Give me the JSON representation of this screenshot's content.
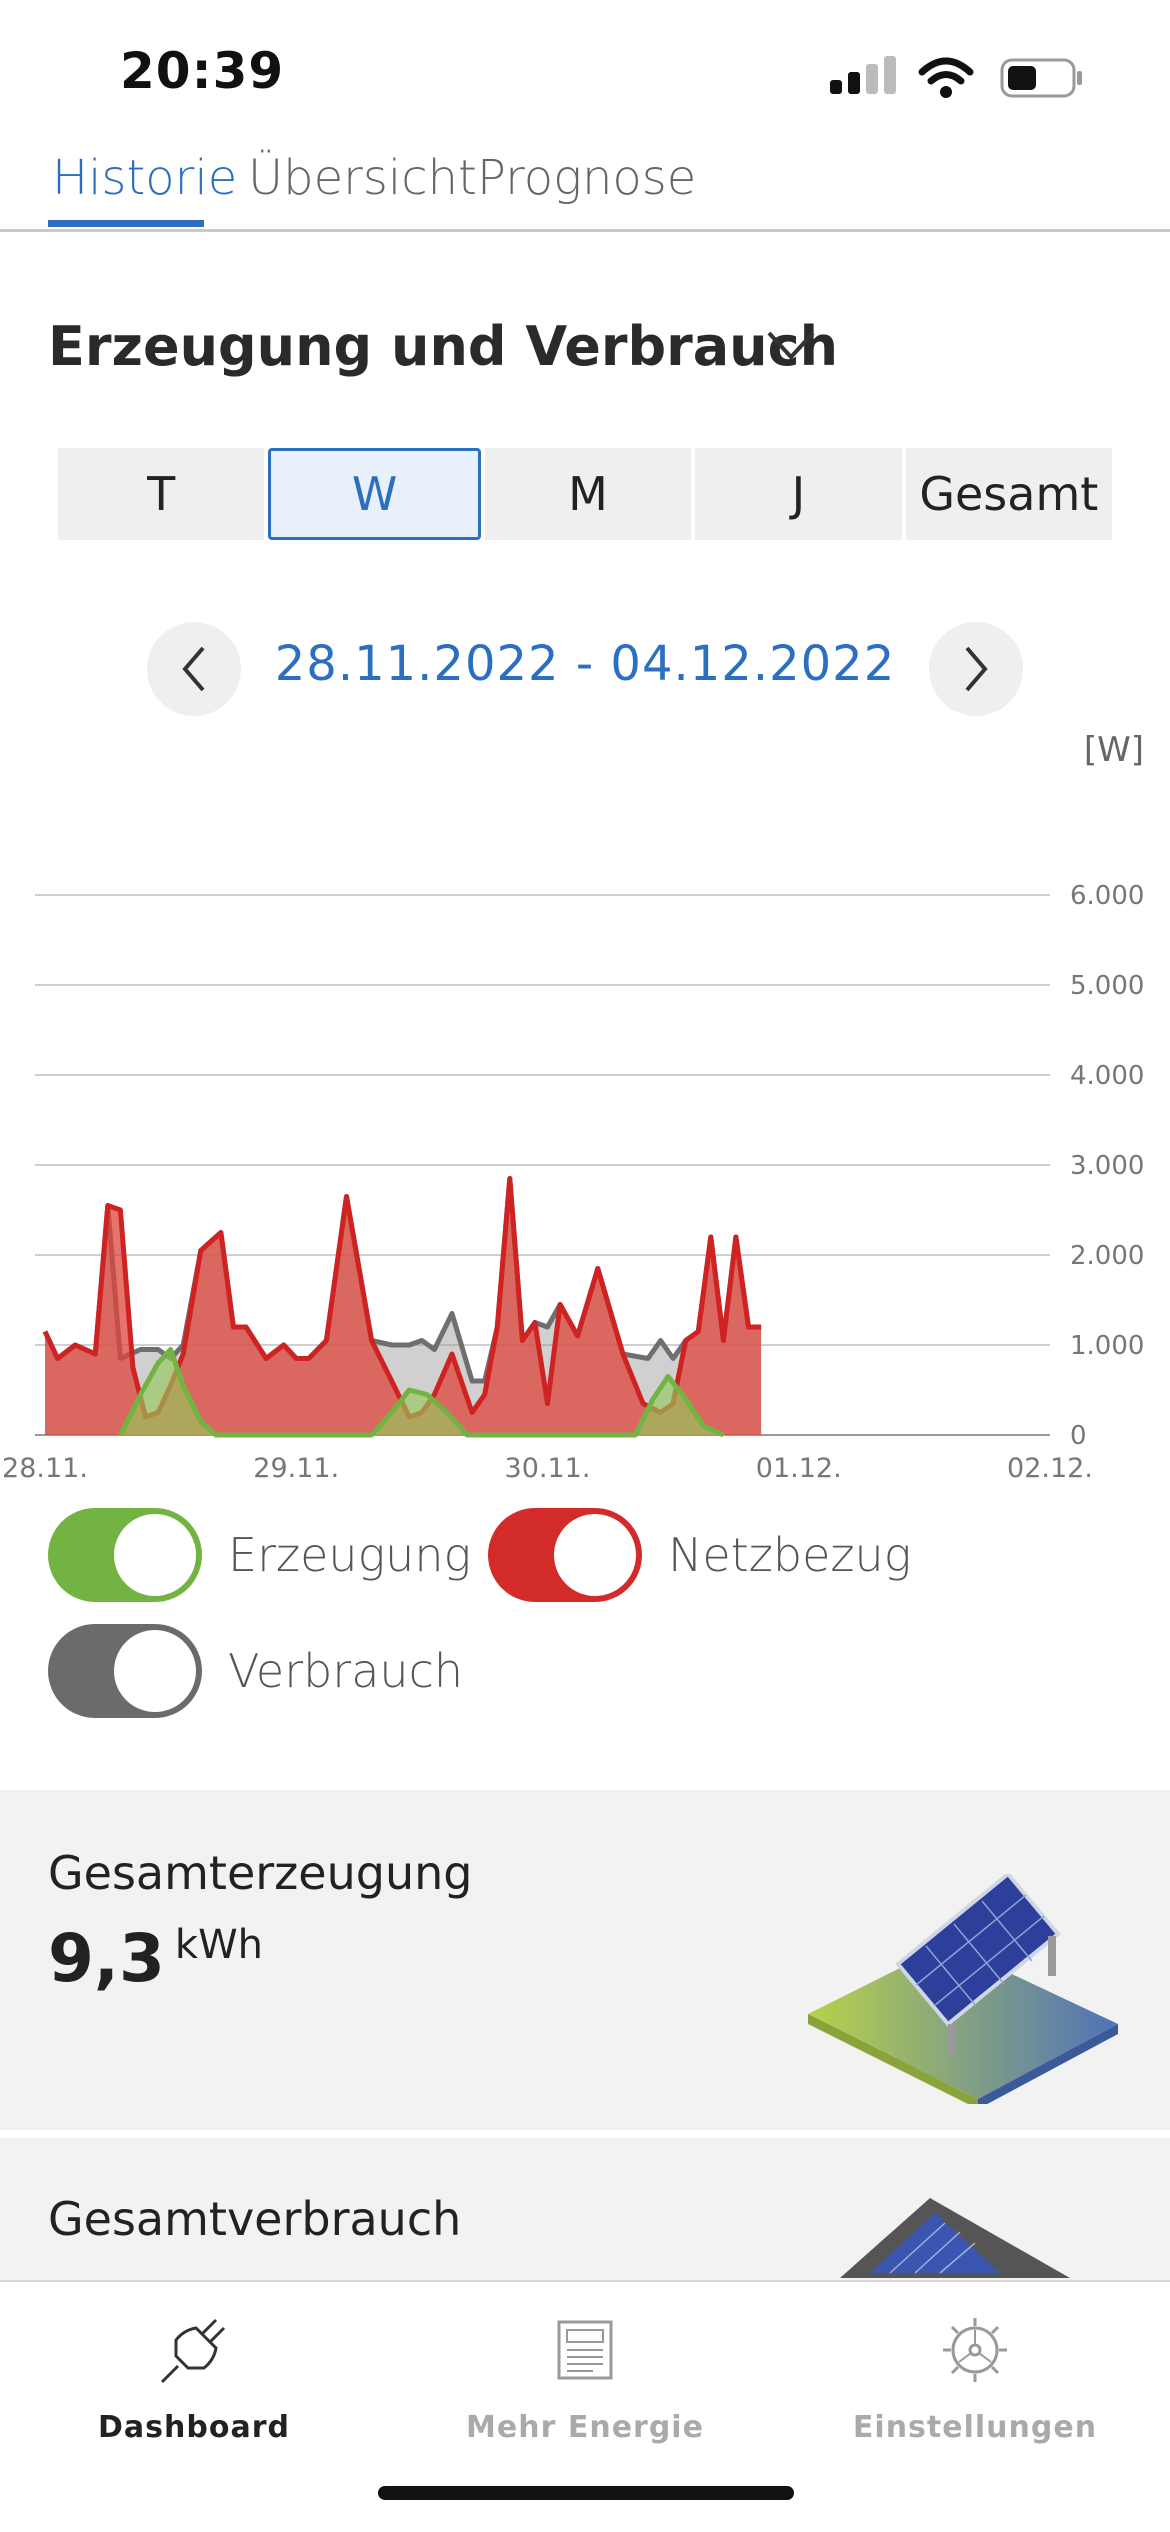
{
  "status": {
    "time": "20:39"
  },
  "tabs": [
    {
      "label": "Historie",
      "active": true
    },
    {
      "label": "Übersicht",
      "active": false
    },
    {
      "label": "Prognose",
      "active": false
    }
  ],
  "section": {
    "title": "Erzeugung und Verbrauch"
  },
  "periods": [
    {
      "label": "T",
      "active": false
    },
    {
      "label": "W",
      "active": true
    },
    {
      "label": "M",
      "active": false
    },
    {
      "label": "J",
      "active": false
    },
    {
      "label": "Gesamt",
      "active": false
    }
  ],
  "date_range": "28.11.2022 - 04.12.2022",
  "unit_label": "[W]",
  "chart_data": {
    "type": "area",
    "x_ticks": [
      "28.11.",
      "29.11.",
      "30.11.",
      "01.12.",
      "02.12."
    ],
    "y_ticks": [
      "0",
      "1.000",
      "2.000",
      "3.000",
      "4.000",
      "5.000",
      "6.000"
    ],
    "ylim": [
      0,
      6000
    ],
    "xlim": [
      0,
      4
    ],
    "grid": true,
    "colors": {
      "erzeugung": "#73b342",
      "netzbezug": "#d32a2a",
      "verbrauch": "#7a7a7a"
    },
    "series": [
      {
        "name": "Verbrauch",
        "x": [
          0,
          0.05,
          0.12,
          0.2,
          0.25,
          0.3,
          0.38,
          0.45,
          0.5,
          0.55,
          0.62,
          0.7,
          0.75,
          0.8,
          0.88,
          0.95,
          1.0,
          1.05,
          1.12,
          1.2,
          1.3,
          1.38,
          1.45,
          1.5,
          1.55,
          1.62,
          1.7,
          1.75,
          1.8,
          1.85,
          1.9,
          1.95,
          2.0,
          2.05,
          2.12,
          2.2,
          2.3,
          2.4,
          2.45,
          2.5,
          2.55,
          2.6,
          2.65,
          2.7,
          2.75,
          2.8,
          2.85
        ],
        "values": [
          1150,
          850,
          1000,
          900,
          2550,
          850,
          950,
          950,
          850,
          1000,
          2050,
          2250,
          1200,
          1200,
          850,
          1000,
          850,
          850,
          1050,
          2650,
          1050,
          1000,
          1000,
          1050,
          950,
          1350,
          600,
          600,
          1200,
          2850,
          1050,
          1250,
          1200,
          1450,
          1100,
          1850,
          900,
          850,
          1050,
          850,
          1050,
          1150,
          2200,
          1050,
          2200,
          1200,
          1200
        ]
      },
      {
        "name": "Netzbezug",
        "x": [
          0,
          0.05,
          0.12,
          0.2,
          0.25,
          0.3,
          0.35,
          0.4,
          0.45,
          0.5,
          0.55,
          0.62,
          0.7,
          0.75,
          0.8,
          0.88,
          0.95,
          1.0,
          1.05,
          1.12,
          1.2,
          1.3,
          1.38,
          1.45,
          1.5,
          1.55,
          1.62,
          1.7,
          1.75,
          1.8,
          1.85,
          1.9,
          1.95,
          2.0,
          2.05,
          2.12,
          2.2,
          2.3,
          2.38,
          2.45,
          2.5,
          2.55,
          2.6,
          2.65,
          2.7,
          2.75,
          2.8,
          2.85
        ],
        "values": [
          1150,
          850,
          1000,
          900,
          2550,
          2500,
          750,
          200,
          250,
          550,
          900,
          2050,
          2250,
          1200,
          1200,
          850,
          1000,
          850,
          850,
          1050,
          2650,
          1050,
          600,
          200,
          250,
          450,
          900,
          250,
          450,
          1200,
          2850,
          1050,
          1250,
          350,
          1450,
          1100,
          1850,
          900,
          350,
          250,
          350,
          1050,
          1150,
          2200,
          1050,
          2200,
          1200,
          1200
        ]
      },
      {
        "name": "Erzeugung",
        "x": [
          0.3,
          0.38,
          0.45,
          0.5,
          0.55,
          0.62,
          0.68,
          1.3,
          1.38,
          1.45,
          1.52,
          1.6,
          1.68,
          2.35,
          2.42,
          2.48,
          2.55,
          2.62,
          2.7
        ],
        "values": [
          0,
          450,
          800,
          950,
          550,
          150,
          0,
          0,
          250,
          500,
          450,
          250,
          0,
          0,
          400,
          650,
          400,
          100,
          0
        ]
      }
    ]
  },
  "toggles": [
    {
      "label": "Erzeugung",
      "color": "#73b342",
      "on": true
    },
    {
      "label": "Netzbezug",
      "color": "#d32a2a",
      "on": true
    },
    {
      "label": "Verbrauch",
      "color": "#6b6b6b",
      "on": true
    }
  ],
  "cards": [
    {
      "title": "Gesamterzeugung",
      "value": "9,3",
      "unit": "kWh"
    },
    {
      "title": "Gesamtverbrauch"
    }
  ],
  "bottom_nav": [
    {
      "label": "Dashboard",
      "icon": "plug-icon",
      "active": true
    },
    {
      "label": "Mehr Energie",
      "icon": "newspaper-icon",
      "active": false
    },
    {
      "label": "Einstellungen",
      "icon": "gear-icon",
      "active": false
    }
  ]
}
